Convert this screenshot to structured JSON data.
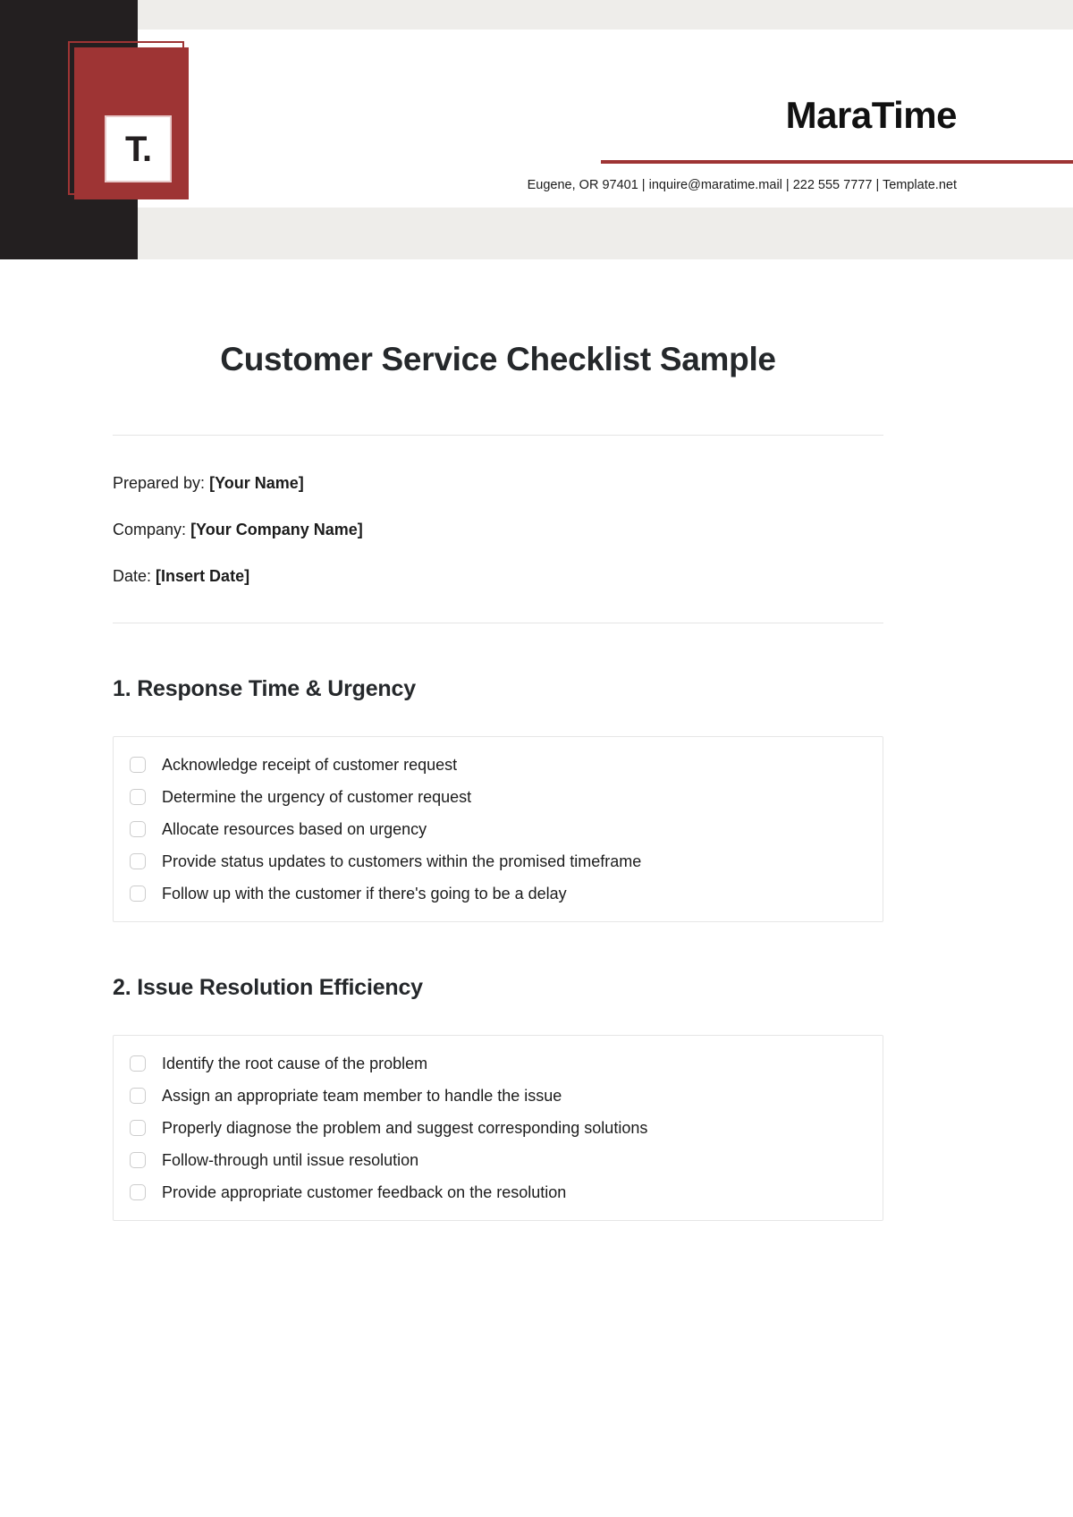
{
  "letterhead": {
    "logo_mark": "T.",
    "brand_name": "MaraTime",
    "contact_line": "Eugene, OR 97401 | inquire@maratime.mail | 222 555 7777 | Template.net",
    "accent_color": "#9e3434",
    "dark_color": "#231f20",
    "band_color": "#eeedea"
  },
  "document": {
    "title": "Customer Service Checklist Sample",
    "meta": [
      {
        "label": "Prepared by:",
        "value": "[Your Name]"
      },
      {
        "label": "Company:",
        "value": "[Your Company Name]"
      },
      {
        "label": "Date:",
        "value": "[Insert Date]"
      }
    ],
    "sections": [
      {
        "heading": "1. Response Time & Urgency",
        "items": [
          "Acknowledge receipt of customer request",
          "Determine the urgency of customer request",
          "Allocate resources based on urgency",
          "Provide status updates to customers within the promised timeframe",
          "Follow up with the customer if there's going to be a delay"
        ]
      },
      {
        "heading": "2. Issue Resolution Efficiency",
        "items": [
          "Identify the root cause of the problem",
          "Assign an appropriate team member to handle the issue",
          "Properly diagnose the problem and suggest corresponding solutions",
          "Follow-through until issue resolution",
          "Provide appropriate customer feedback on the resolution"
        ]
      }
    ]
  }
}
